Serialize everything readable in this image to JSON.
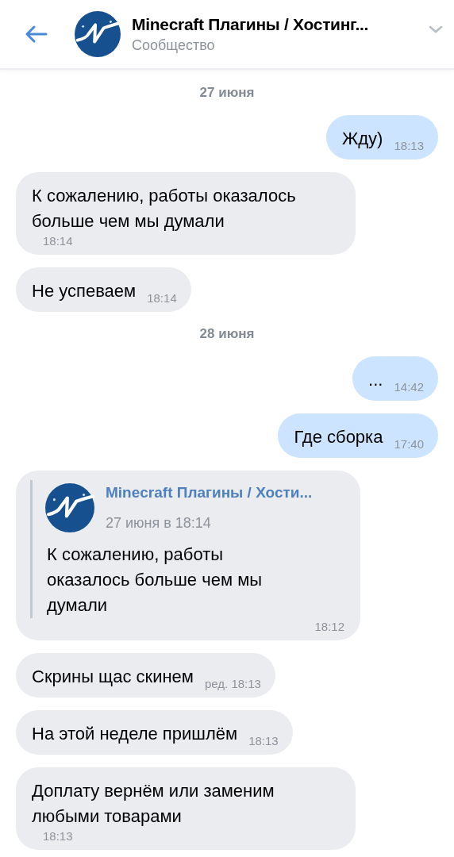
{
  "header": {
    "title": "Minecraft Плагины / Хостинг...",
    "subtitle": "Сообщество"
  },
  "messages": [
    {
      "kind": "date",
      "text": "27 июня"
    },
    {
      "kind": "out",
      "text": "Жду)",
      "time": "18:13"
    },
    {
      "kind": "in",
      "text": "К сожалению, работы оказалось больше чем мы думали",
      "time": "18:14"
    },
    {
      "kind": "in",
      "text": "Не успеваем",
      "time": "18:14"
    },
    {
      "kind": "date",
      "text": "28 июня"
    },
    {
      "kind": "out",
      "text": "...",
      "time": "14:42"
    },
    {
      "kind": "out",
      "text": "Где сборка",
      "time": "17:40"
    },
    {
      "kind": "forward",
      "quote": {
        "author": "Minecraft Плагины / Хости...",
        "date": "27 июня в 18:14",
        "text": "К сожалению, работы оказалось больше чем мы думали"
      },
      "time": "18:12"
    },
    {
      "kind": "in",
      "text": "Скрины щас скинем",
      "time": "ред. 18:13"
    },
    {
      "kind": "in",
      "text": "На этой неделе пришлём",
      "time": "18:13"
    },
    {
      "kind": "in",
      "text": "Доплату вернём или заменим любыми товарами",
      "time": "18:13"
    }
  ]
}
